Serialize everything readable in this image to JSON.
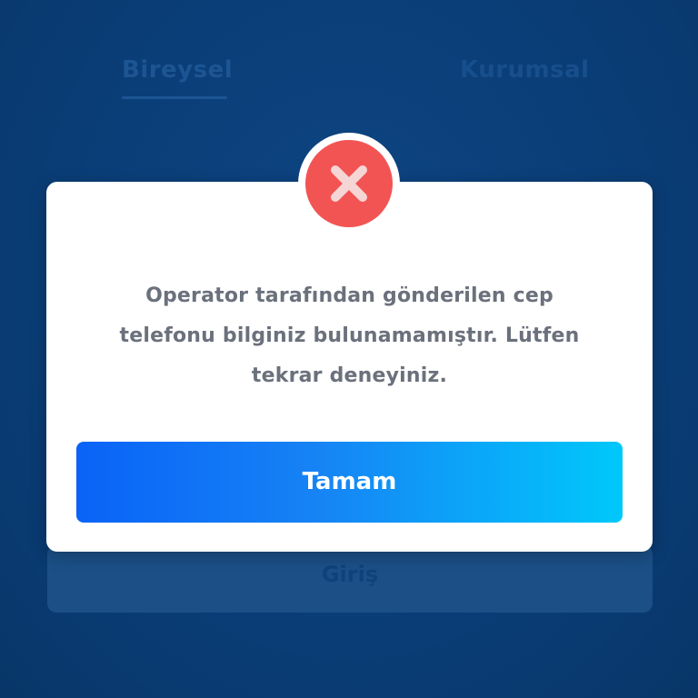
{
  "tabs": [
    {
      "label": "Bireysel",
      "active": true
    },
    {
      "label": "Kurumsal",
      "active": false
    }
  ],
  "login": {
    "label": "Giriş"
  },
  "dialog": {
    "icon": "close-x-icon",
    "message": "Operator tarafından gönderilen cep telefonu bilginiz bulunamamıştır. Lütfen tekrar deneyiniz.",
    "ok_label": "Tamam"
  },
  "colors": {
    "background": "#0b3f78",
    "error_red": "#f25454",
    "button_gradient_start": "#0a63f6",
    "button_gradient_end": "#00c8fb"
  }
}
